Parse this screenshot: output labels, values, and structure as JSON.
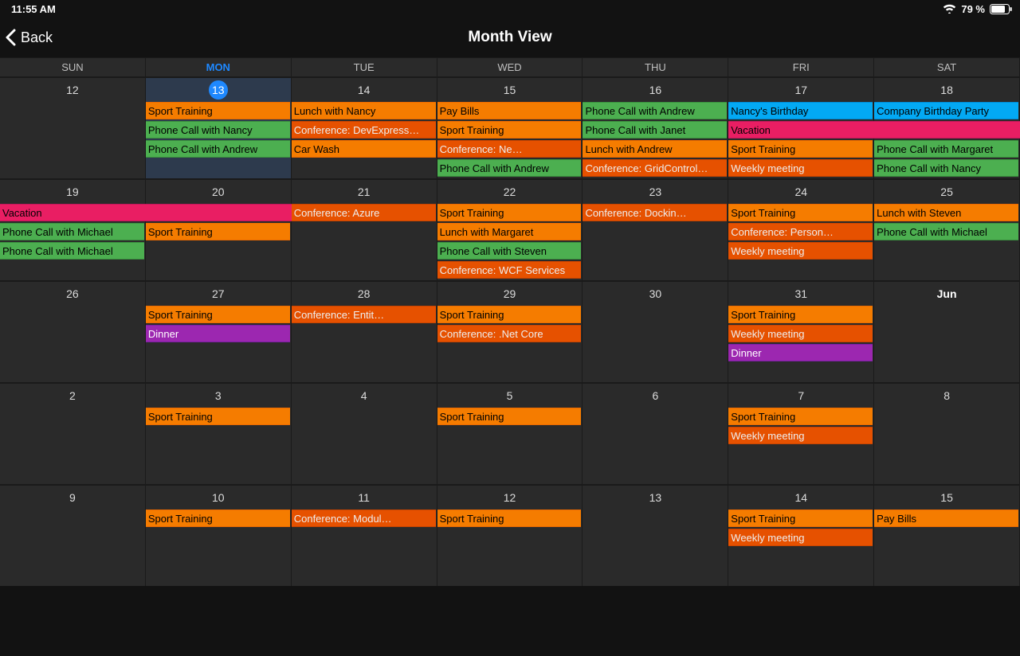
{
  "statusbar": {
    "time": "11:55 AM",
    "battery": "79 %"
  },
  "nav": {
    "back": "Back",
    "title": "Month View"
  },
  "dayHeaders": [
    "SUN",
    "MON",
    "TUE",
    "WED",
    "THU",
    "FRI",
    "SAT"
  ],
  "todayColIndex": 1,
  "weeks": [
    {
      "dates": [
        "12",
        "13",
        "14",
        "15",
        "16",
        "17",
        "18"
      ],
      "today": 1,
      "selected": 1,
      "slots": 4,
      "colEvents": {
        "1": [
          {
            "t": "Sport Training",
            "c": "orange"
          },
          {
            "t": "Phone Call with Nancy",
            "c": "ltgreen"
          },
          {
            "t": "Phone Call with Andrew",
            "c": "ltgreen"
          }
        ],
        "2": [
          {
            "t": "Lunch with Nancy",
            "c": "orange"
          },
          {
            "t": "Conference: DevExpress…",
            "c": "dkorange"
          },
          {
            "t": "Car Wash",
            "c": "orange"
          }
        ],
        "3": [
          {
            "t": "Pay Bills",
            "c": "orange"
          },
          {
            "t": "Sport Training",
            "c": "orange"
          },
          {
            "t": "Conference: Ne…",
            "c": "dkorange"
          },
          {
            "t": "Phone Call with Andrew",
            "c": "ltgreen"
          }
        ],
        "4": [
          {
            "t": "Phone Call with Andrew",
            "c": "ltgreen"
          },
          {
            "t": "Phone Call with Janet",
            "c": "ltgreen"
          },
          {
            "t": "Lunch with Andrew",
            "c": "orange"
          },
          {
            "t": "Conference: GridControl…",
            "c": "dkorange"
          }
        ],
        "5": [
          {
            "t": "Nancy's Birthday",
            "c": "blue"
          },
          null,
          {
            "t": "Sport Training",
            "c": "orange"
          },
          {
            "t": "Weekly meeting",
            "c": "dkorange"
          }
        ],
        "6": [
          {
            "t": "Company Birthday Party",
            "c": "blue"
          },
          null,
          {
            "t": "Phone Call with Margaret",
            "c": "ltgreen"
          },
          {
            "t": "Phone Call with Nancy",
            "c": "ltgreen"
          }
        ]
      },
      "spans": [
        {
          "slot": 1,
          "fromCol": 5,
          "toCol": 6,
          "t": "Vacation",
          "c": "pink"
        }
      ]
    },
    {
      "dates": [
        "19",
        "20",
        "21",
        "22",
        "23",
        "24",
        "25"
      ],
      "slots": 4,
      "colEvents": {
        "0": [
          null,
          {
            "t": "Phone Call with Michael",
            "c": "ltgreen"
          },
          {
            "t": "Phone Call with Michael",
            "c": "ltgreen"
          }
        ],
        "1": [
          null,
          {
            "t": "Sport Training",
            "c": "orange"
          }
        ],
        "2": [
          {
            "t": "Conference: Azure",
            "c": "dkorange"
          }
        ],
        "3": [
          {
            "t": "Sport Training",
            "c": "orange"
          },
          {
            "t": "Lunch with Margaret",
            "c": "orange"
          },
          {
            "t": "Phone Call with Steven",
            "c": "ltgreen"
          },
          {
            "t": "Conference: WCF Services",
            "c": "dkorange"
          }
        ],
        "4": [
          {
            "t": "Conference: Dockin…",
            "c": "dkorange"
          }
        ],
        "5": [
          {
            "t": "Sport Training",
            "c": "orange"
          },
          {
            "t": "Conference: Person…",
            "c": "dkorange"
          },
          {
            "t": "Weekly meeting",
            "c": "dkorange"
          }
        ],
        "6": [
          {
            "t": "Lunch with Steven",
            "c": "orange"
          },
          {
            "t": "Phone Call with Michael",
            "c": "ltgreen"
          }
        ]
      },
      "spans": [
        {
          "slot": 0,
          "fromCol": 0,
          "toCol": 1,
          "t": "Vacation",
          "c": "pink"
        }
      ]
    },
    {
      "dates": [
        "26",
        "27",
        "28",
        "29",
        "30",
        "31",
        "Jun"
      ],
      "boldLast": true,
      "slots": 4,
      "colEvents": {
        "1": [
          {
            "t": "Sport Training",
            "c": "orange"
          },
          {
            "t": "Dinner",
            "c": "purple"
          }
        ],
        "2": [
          {
            "t": "Conference: Entit…",
            "c": "dkorange"
          }
        ],
        "3": [
          {
            "t": "Sport Training",
            "c": "orange"
          },
          {
            "t": "Conference: .Net Core",
            "c": "dkorange"
          }
        ],
        "5": [
          {
            "t": "Sport Training",
            "c": "orange"
          },
          {
            "t": "Weekly meeting",
            "c": "dkorange"
          },
          {
            "t": "Dinner",
            "c": "purple"
          }
        ]
      }
    },
    {
      "dates": [
        "2",
        "3",
        "4",
        "5",
        "6",
        "7",
        "8"
      ],
      "slots": 4,
      "colEvents": {
        "1": [
          {
            "t": "Sport Training",
            "c": "orange"
          }
        ],
        "3": [
          {
            "t": "Sport Training",
            "c": "orange"
          }
        ],
        "5": [
          {
            "t": "Sport Training",
            "c": "orange"
          },
          {
            "t": "Weekly meeting",
            "c": "dkorange"
          }
        ]
      }
    },
    {
      "dates": [
        "9",
        "10",
        "11",
        "12",
        "13",
        "14",
        "15"
      ],
      "slots": 4,
      "colEvents": {
        "1": [
          {
            "t": "Sport Training",
            "c": "orange"
          }
        ],
        "2": [
          {
            "t": "Conference: Modul…",
            "c": "dkorange"
          }
        ],
        "3": [
          {
            "t": "Sport Training",
            "c": "orange"
          }
        ],
        "5": [
          {
            "t": "Sport Training",
            "c": "orange"
          },
          {
            "t": "Weekly meeting",
            "c": "dkorange"
          }
        ],
        "6": [
          {
            "t": "Pay Bills",
            "c": "orange"
          }
        ]
      }
    }
  ]
}
